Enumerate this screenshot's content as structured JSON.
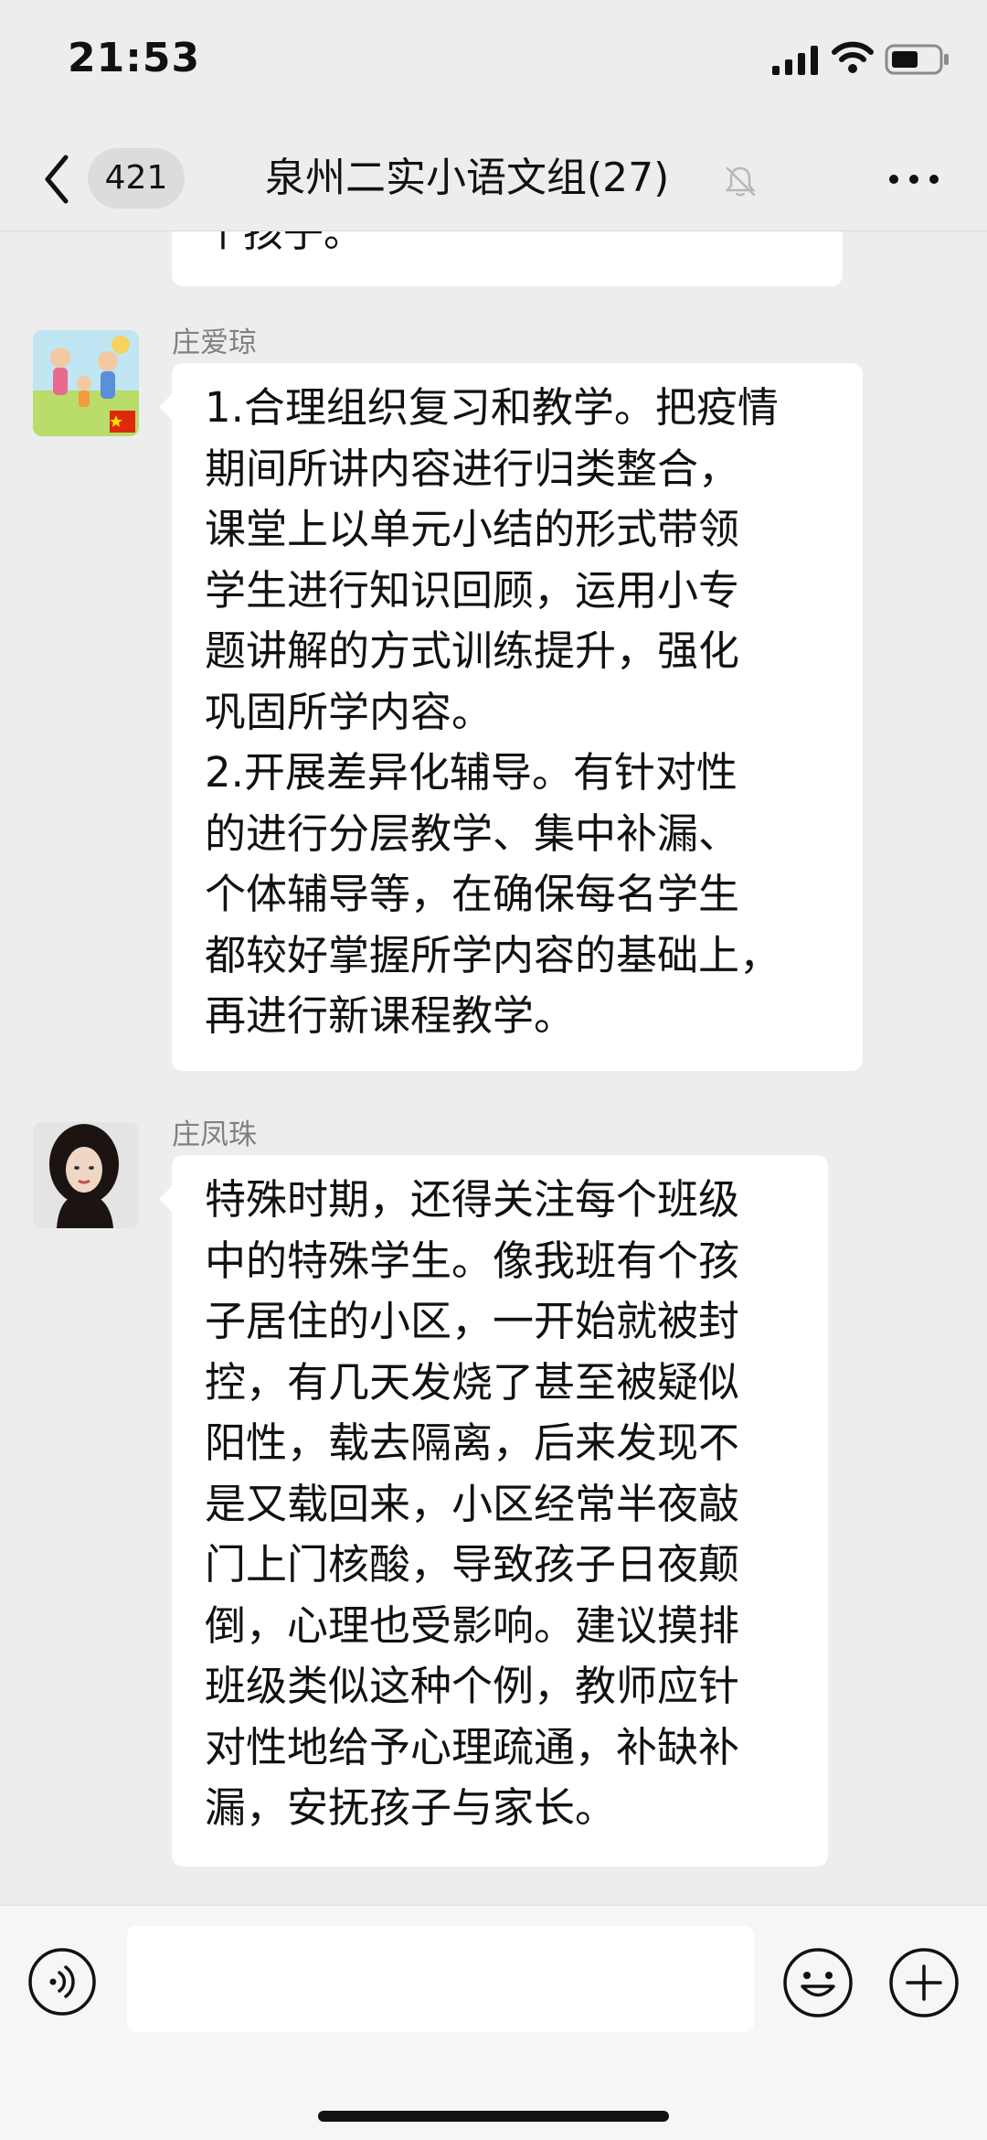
{
  "status_bar": {
    "time": "21:53",
    "icons": [
      "signal-icon",
      "wifi-icon",
      "battery-icon"
    ]
  },
  "nav": {
    "back_icon": "chevron-left-icon",
    "unread_count": "421",
    "title": "泉州二实小语文组(27)",
    "mute_icon": "bell-off-icon",
    "more_icon": "more-dots-icon"
  },
  "messages": {
    "partial_previous": "个孩子。",
    "items": [
      {
        "sender": "庄爱琼",
        "avatar": "cartoon-family-avatar",
        "text": "1.合理组织复习和教学。把疫情\n期间所讲内容进行归类整合，\n课堂上以单元小结的形式带领\n学生进行知识回顾，运用小专\n题讲解的方式训练提升，强化\n巩固所学内容。\n2.开展差异化辅导。有针对性\n的进行分层教学、集中补漏、\n个体辅导等，在确保每名学生\n都较好掌握所学内容的基础上，\n再进行新课程教学。"
      },
      {
        "sender": "庄凤珠",
        "avatar": "woman-photo-avatar",
        "text": "特殊时期，还得关注每个班级\n中的特殊学生。像我班有个孩\n子居住的小区，一开始就被封\n控，有几天发烧了甚至被疑似\n阳性，载去隔离，后来发现不\n是又载回来，小区经常半夜敲\n门上门核酸，导致孩子日夜颠\n倒，心理也受影响。建议摸排\n班级类似这种个例，教师应针\n对性地给予心理疏通，补缺补\n漏，安抚孩子与家长。"
      }
    ]
  },
  "input_bar": {
    "voice_icon": "voice-icon",
    "input_value": "",
    "emoji_icon": "emoji-icon",
    "add_icon": "plus-circle-icon"
  },
  "colors": {
    "background": "#ededed",
    "bubble": "#ffffff",
    "sender_name": "#808080",
    "text": "#111111"
  }
}
